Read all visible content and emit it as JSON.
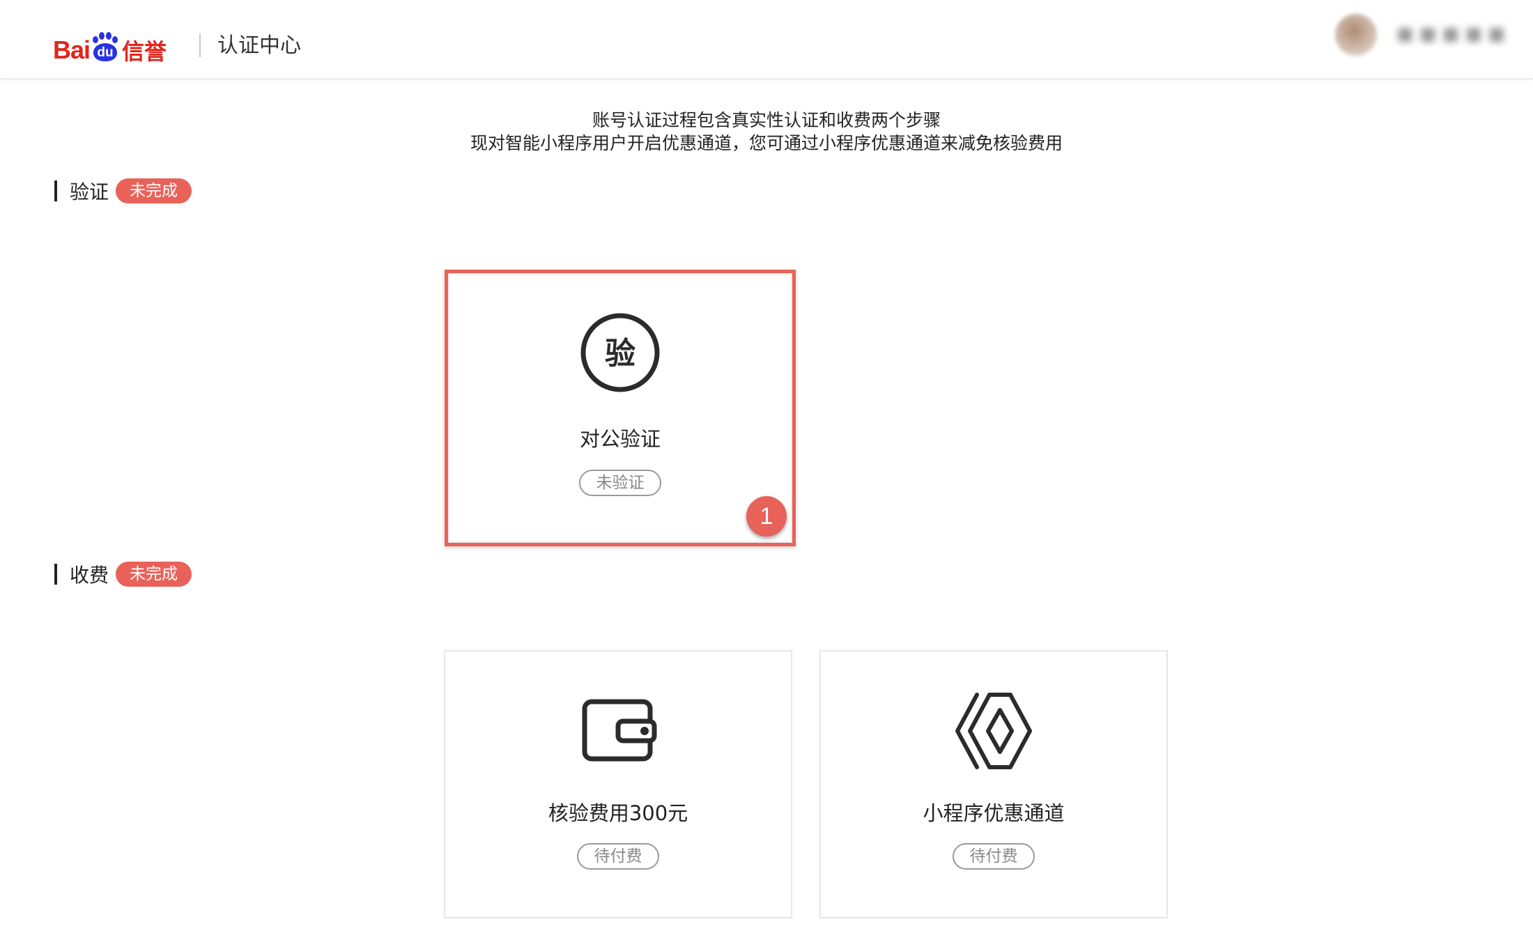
{
  "header": {
    "logo_bai": "Bai",
    "logo_du": "du",
    "logo_xinyu": "信誉",
    "title": "认证中心",
    "user_name": "■ ■ ■ ■ ■"
  },
  "intro": {
    "line1": "账号认证过程包含真实性认证和收费两个步骤",
    "line2": "现对智能小程序用户开启优惠通道，您可通过小程序优惠通道来减免核验费用"
  },
  "verify_section": {
    "title": "验证",
    "status": "未完成",
    "cards": [
      {
        "icon": "verify-seal-icon",
        "icon_char": "验",
        "title": "对公验证",
        "status": "未验证",
        "step_number": "1"
      }
    ]
  },
  "payment_section": {
    "title": "收费",
    "status": "未完成",
    "cards": [
      {
        "icon": "wallet-icon",
        "title": "核验费用300元",
        "status": "待付费"
      },
      {
        "icon": "diamond-channel-icon",
        "title": "小程序优惠通道",
        "status": "待付费"
      }
    ]
  },
  "colors": {
    "brand_red": "#e1261c",
    "brand_blue": "#2932e1",
    "badge_red": "#e8625a",
    "text_dark": "#222222",
    "border_light": "#e6e6e6"
  }
}
